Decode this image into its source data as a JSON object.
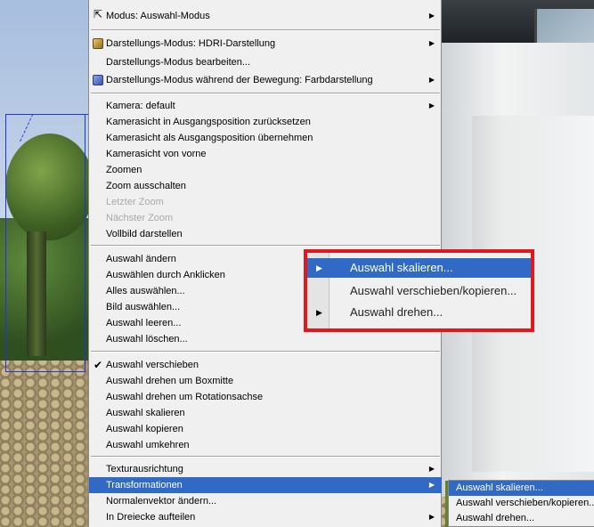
{
  "context_menu": {
    "items": [
      {
        "id": "modus",
        "label": "Modus:  Auswahl-Modus",
        "icon": "cursor-icon",
        "submenu": true
      },
      {
        "id": "darstellungsmodus",
        "label": "Darstellungs-Modus: HDRI-Darstellung",
        "icon": "render-mode-icon",
        "submenu": true
      },
      {
        "id": "darstellungsmodus-bearbeiten",
        "label": "Darstellungs-Modus bearbeiten..."
      },
      {
        "id": "darstellungsmodus-bewegung",
        "label": "Darstellungs-Modus während der Bewegung: Farbdarstellung",
        "icon": "motion-render-icon",
        "submenu": true
      },
      {
        "id": "kamera",
        "label": "Kamera: default",
        "submenu": true
      },
      {
        "id": "kamera-zuruecksetzen",
        "label": "Kamerasicht in Ausgangsposition zurücksetzen"
      },
      {
        "id": "kamera-uebernehmen",
        "label": "Kamerasicht als Ausgangsposition übernehmen"
      },
      {
        "id": "kamera-vorne",
        "label": "Kamerasicht von vorne"
      },
      {
        "id": "zoomen",
        "label": "Zoomen"
      },
      {
        "id": "zoom-aus",
        "label": "Zoom ausschalten"
      },
      {
        "id": "letzter-zoom",
        "label": "Letzter Zoom",
        "disabled": true
      },
      {
        "id": "naechster-zoom",
        "label": "Nächster Zoom",
        "disabled": true
      },
      {
        "id": "vollbild",
        "label": "Vollbild darstellen"
      },
      {
        "id": "auswahl-aendern",
        "label": "Auswahl ändern"
      },
      {
        "id": "auswaehlen-anklicken",
        "label": "Auswählen durch Anklicken"
      },
      {
        "id": "alles-auswaehlen",
        "label": "Alles auswählen..."
      },
      {
        "id": "bild-auswaehlen",
        "label": "Bild auswählen..."
      },
      {
        "id": "auswahl-leeren",
        "label": "Auswahl leeren..."
      },
      {
        "id": "auswahl-loeschen",
        "label": "Auswahl löschen..."
      },
      {
        "id": "auswahl-verschieben",
        "label": "Auswahl verschieben",
        "checked": true
      },
      {
        "id": "auswahl-drehen-boxmitte",
        "label": "Auswahl drehen um Boxmitte"
      },
      {
        "id": "auswahl-drehen-rotationsachse",
        "label": "Auswahl drehen um Rotationsachse"
      },
      {
        "id": "auswahl-skalieren",
        "label": "Auswahl skalieren"
      },
      {
        "id": "auswahl-kopieren",
        "label": "Auswahl kopieren"
      },
      {
        "id": "auswahl-umkehren",
        "label": "Auswahl umkehren"
      },
      {
        "id": "texturausrichtung",
        "label": "Texturausrichtung",
        "submenu": true
      },
      {
        "id": "transformationen",
        "label": "Transformationen",
        "submenu": true,
        "highlighted": true
      },
      {
        "id": "normalenvektor",
        "label": "Normalenvektor ändern..."
      },
      {
        "id": "dreiecke",
        "label": "In Dreiecke aufteilen",
        "submenu": true
      }
    ]
  },
  "zoomed_submenu": {
    "items": [
      {
        "label": "Auswahl skalieren...",
        "arrow": true,
        "highlighted": true
      },
      {
        "label": "Auswahl verschieben/kopieren...",
        "arrow": false
      },
      {
        "label": "Auswahl drehen...",
        "arrow": true
      }
    ]
  },
  "transform_submenu": {
    "items": [
      {
        "label": "Auswahl skalieren...",
        "highlighted": true
      },
      {
        "label": "Auswahl verschieben/kopieren..."
      },
      {
        "label": "Auswahl drehen..."
      }
    ]
  },
  "icons": {
    "check": "✔",
    "arrow": "▶",
    "cursor": "⇱"
  },
  "colors": {
    "highlight": "#316ac5",
    "frame": "#e3181f"
  }
}
